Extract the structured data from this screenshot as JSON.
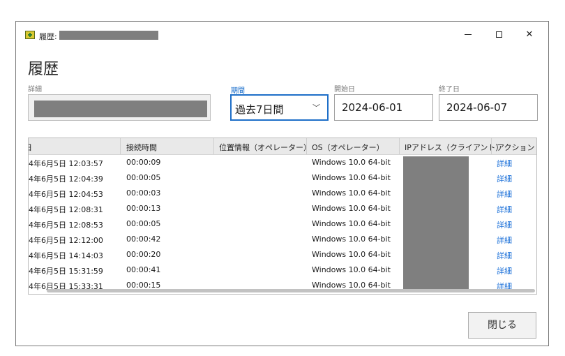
{
  "window": {
    "title": "履歴:",
    "controls": {
      "minimize": "minimize-icon",
      "maximize": "maximize-icon",
      "close": "close-icon"
    }
  },
  "page": {
    "title": "履歴"
  },
  "filters": {
    "detail_label": "詳細",
    "period_label": "期間",
    "period_value": "過去7日間",
    "start_label": "開始日",
    "start_value": "2024-06-01",
    "end_label": "終了日",
    "end_value": "2024-06-07"
  },
  "table": {
    "columns": [
      "日",
      "接続時間",
      "位置情報（オペレーター）",
      "OS（オペレーター）",
      "IPアドレス（クライアント）",
      "アクション"
    ],
    "rows": [
      {
        "date": "4年6月5日 12:03:57",
        "duration": "00:00:09",
        "location": "",
        "os": "Windows 10.0 64-bit",
        "action": "詳細"
      },
      {
        "date": "4年6月5日 12:04:39",
        "duration": "00:00:05",
        "location": "",
        "os": "Windows 10.0 64-bit",
        "action": "詳細"
      },
      {
        "date": "4年6月5日 12:04:53",
        "duration": "00:00:03",
        "location": "",
        "os": "Windows 10.0 64-bit",
        "action": "詳細"
      },
      {
        "date": "4年6月5日 12:08:31",
        "duration": "00:00:13",
        "location": "",
        "os": "Windows 10.0 64-bit",
        "action": "詳細"
      },
      {
        "date": "4年6月5日 12:08:53",
        "duration": "00:00:05",
        "location": "",
        "os": "Windows 10.0 64-bit",
        "action": "詳細"
      },
      {
        "date": "4年6月5日 12:12:00",
        "duration": "00:00:42",
        "location": "",
        "os": "Windows 10.0 64-bit",
        "action": "詳細"
      },
      {
        "date": "4年6月5日 14:14:03",
        "duration": "00:00:20",
        "location": "",
        "os": "Windows 10.0 64-bit",
        "action": "詳細"
      },
      {
        "date": "4年6月5日 15:31:59",
        "duration": "00:00:41",
        "location": "",
        "os": "Windows 10.0 64-bit",
        "action": "詳細"
      },
      {
        "date": "4年6月5日 15:33:31",
        "duration": "00:00:15",
        "location": "",
        "os": "Windows 10.0 64-bit",
        "action": "詳細"
      }
    ]
  },
  "footer": {
    "close_label": "閉じる"
  },
  "colors": {
    "accent": "#1e6fc8",
    "link": "#1a6fd8",
    "redaction": "#7f7f7f"
  }
}
